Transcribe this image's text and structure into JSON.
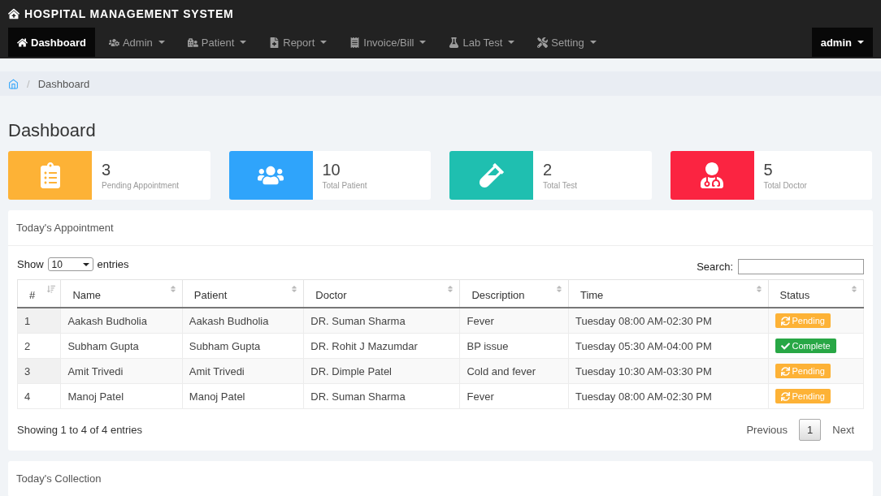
{
  "app_title": "HOSPITAL MANAGEMENT SYSTEM",
  "nav": [
    {
      "label": "Dashboard",
      "selected": true,
      "dropdown": false
    },
    {
      "label": "Admin",
      "selected": false,
      "dropdown": true
    },
    {
      "label": "Patient",
      "selected": false,
      "dropdown": true
    },
    {
      "label": "Report",
      "selected": false,
      "dropdown": true
    },
    {
      "label": "Invoice/Bill",
      "selected": false,
      "dropdown": true
    },
    {
      "label": "Lab Test",
      "selected": false,
      "dropdown": true
    },
    {
      "label": "Setting",
      "selected": false,
      "dropdown": true
    }
  ],
  "user_menu": "admin",
  "breadcrumb_separator": "/",
  "breadcrumb": [
    "Dashboard"
  ],
  "page_title": "Dashboard",
  "stats": [
    {
      "value": "3",
      "label": "Pending Appointment",
      "color": "#fdb236"
    },
    {
      "value": "10",
      "label": "Total Patient",
      "color": "#2fa4fb"
    },
    {
      "value": "2",
      "label": "Total Test",
      "color": "#1fbfb0"
    },
    {
      "value": "5",
      "label": "Total Doctor",
      "color": "#fb2441"
    }
  ],
  "appointments": {
    "title": "Today's Appointment",
    "show_label": "Show",
    "page_size": "10",
    "entries_label": "entries",
    "search_label": "Search:",
    "columns": [
      "#",
      "Name",
      "Patient",
      "Doctor",
      "Description",
      "Time",
      "Status"
    ],
    "rows": [
      {
        "cells": [
          "1",
          "Aakash Budholia",
          "Aakash Budholia",
          "DR. Suman Sharma",
          "Fever",
          "Tuesday 08:00 AM-02:30 PM"
        ],
        "status": {
          "kind": "pending",
          "label": "Pending"
        }
      },
      {
        "cells": [
          "2",
          "Subham Gupta",
          "Subham Gupta",
          "DR. Rohit J Mazumdar",
          "BP issue",
          "Tuesday 05:30 AM-04:00 PM"
        ],
        "status": {
          "kind": "complete",
          "label": "Complete"
        }
      },
      {
        "cells": [
          "3",
          "Amit Trivedi",
          "Amit Trivedi",
          "DR. Dimple Patel",
          "Cold and fever",
          "Tuesday 10:30 AM-03:30 PM"
        ],
        "status": {
          "kind": "pending",
          "label": "Pending"
        }
      },
      {
        "cells": [
          "4",
          "Manoj Patel",
          "Manoj Patel",
          "DR. Suman Sharma",
          "Fever",
          "Tuesday 08:00 AM-02:30 PM"
        ],
        "status": {
          "kind": "pending",
          "label": "Pending"
        }
      }
    ],
    "info": "Showing 1 to 4 of 4 entries",
    "pagination": {
      "previous": "Previous",
      "pages": [
        {
          "label": "1",
          "selected": true
        }
      ],
      "next": "Next"
    }
  },
  "collection": {
    "title": "Today's Collection"
  }
}
